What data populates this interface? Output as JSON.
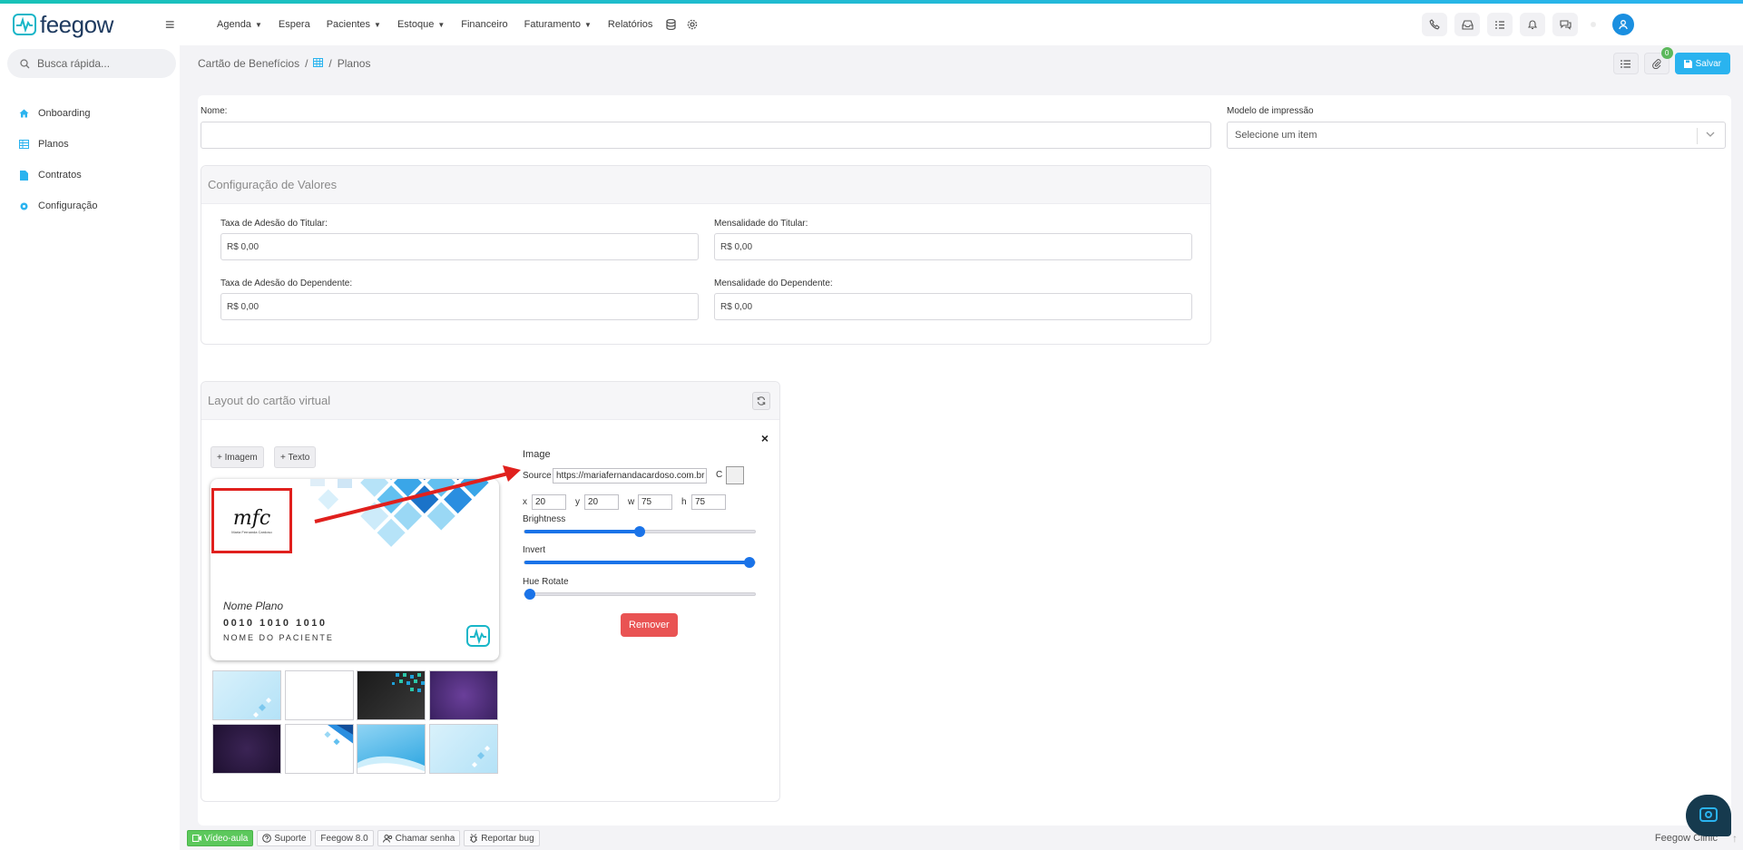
{
  "app": {
    "logo_text": "feegow",
    "accent": "#2ab3ef",
    "brand_dark": "#1e3a5f"
  },
  "topbar": {
    "menu": [
      {
        "label": "Agenda",
        "has_caret": true
      },
      {
        "label": "Espera",
        "has_caret": false
      },
      {
        "label": "Pacientes",
        "has_caret": true
      },
      {
        "label": "Estoque",
        "has_caret": true
      },
      {
        "label": "Financeiro",
        "has_caret": false
      },
      {
        "label": "Faturamento",
        "has_caret": true
      },
      {
        "label": "Relatórios",
        "has_caret": false
      }
    ],
    "icons": [
      "database-icon",
      "gear-icon"
    ],
    "right_icons": [
      "phone-icon",
      "inbox-icon",
      "checklist-icon",
      "bell-icon",
      "chat-icon"
    ]
  },
  "sidebar": {
    "search_placeholder": "Busca rápida...",
    "items": [
      {
        "label": "Onboarding",
        "icon": "home-icon"
      },
      {
        "label": "Planos",
        "icon": "table-icon"
      },
      {
        "label": "Contratos",
        "icon": "document-icon"
      },
      {
        "label": "Configuração",
        "icon": "gear-icon"
      }
    ]
  },
  "breadcrumb": {
    "root": "Cartão de Benefícios",
    "sep": "/",
    "current": "Planos"
  },
  "page_actions": {
    "badge_count": "0",
    "save_label": "Salvar"
  },
  "form": {
    "nome_label": "Nome:",
    "nome_value": "",
    "modelo_label": "Modelo de impressão",
    "modelo_placeholder": "Selecione um item"
  },
  "valores": {
    "title": "Configuração de Valores",
    "taxa_titular_label": "Taxa de Adesão do Titular:",
    "taxa_titular_value": "R$ 0,00",
    "mensal_titular_label": "Mensalidade do Titular:",
    "mensal_titular_value": "R$ 0,00",
    "taxa_dependente_label": "Taxa de Adesão do Dependente:",
    "taxa_dependente_value": "R$ 0,00",
    "mensal_dependente_label": "Mensalidade do Dependente:",
    "mensal_dependente_value": "R$ 0,00"
  },
  "layout_card": {
    "title": "Layout do cartão virtual",
    "add_image": "+ Imagem",
    "add_text": "+ Texto",
    "close": "×",
    "card": {
      "plan_name": "Nome Plano",
      "card_number": "0010 1010 1010",
      "patient_name": "NOME DO PACIENTE",
      "logo_text": "mfc",
      "logo_subtext": "Maria Fernanda Cardoso"
    },
    "editor": {
      "title": "Image",
      "source_label": "Source",
      "source_value": "https://mariafernandacardoso.com.br",
      "c_label": "C",
      "x_label": "x",
      "x_value": "20",
      "y_label": "y",
      "y_value": "20",
      "w_label": "w",
      "w_value": "75",
      "h_label": "h",
      "h_value": "75",
      "brightness_label": "Brightness",
      "brightness_level": 0.5,
      "invert_label": "Invert",
      "invert_level": 1.0,
      "hue_label": "Hue Rotate",
      "hue_level": 0.0,
      "remove_label": "Remover"
    },
    "thumbnails": [
      "light-blue-diamonds",
      "white",
      "dark-pixels",
      "purple-texture",
      "dark-purple",
      "white-blue-diamonds",
      "blue-waves",
      "light-blue-stars"
    ]
  },
  "footer": {
    "video": "Vídeo-aula",
    "support": "Suporte",
    "version": "Feegow 8.0",
    "call": "Chamar senha",
    "bug": "Reportar bug",
    "brand": "Feegow Clinic"
  }
}
